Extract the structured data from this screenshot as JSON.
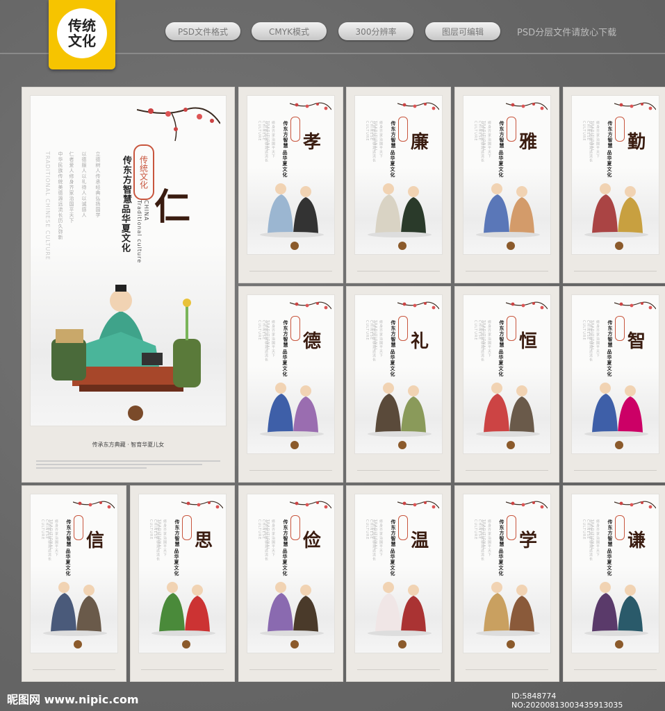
{
  "badge": {
    "line1": "传统",
    "line2": "文化"
  },
  "pills": [
    "PSD文件格式",
    "CMYK模式",
    "300分辨率",
    "图层可编辑"
  ],
  "top_note": "PSD分层文件请放心下载",
  "main_poster": {
    "char": "仁",
    "slogan1": "传东方智慧",
    "slogan2": "品华夏文化",
    "english": "Traditional culture",
    "china": "CHINA",
    "stamp": "传统文化",
    "footer": "传承东方典藏 · 智育华夏儿女"
  },
  "small_posters": [
    {
      "char": "孝"
    },
    {
      "char": "廉"
    },
    {
      "char": "雅"
    },
    {
      "char": "勤"
    },
    {
      "char": "德"
    },
    {
      "char": "礼"
    },
    {
      "char": "恒"
    },
    {
      "char": "智"
    },
    {
      "char": "信"
    },
    {
      "char": "思"
    },
    {
      "char": "俭"
    },
    {
      "char": "温"
    },
    {
      "char": "学"
    },
    {
      "char": "谦"
    }
  ],
  "small_slogan1": "传东方智慧",
  "small_slogan2": "品华夏文化",
  "watermark": "昵图网 www.nipic.com",
  "id_text": "ID:5848774 NO:20200813003435913035"
}
